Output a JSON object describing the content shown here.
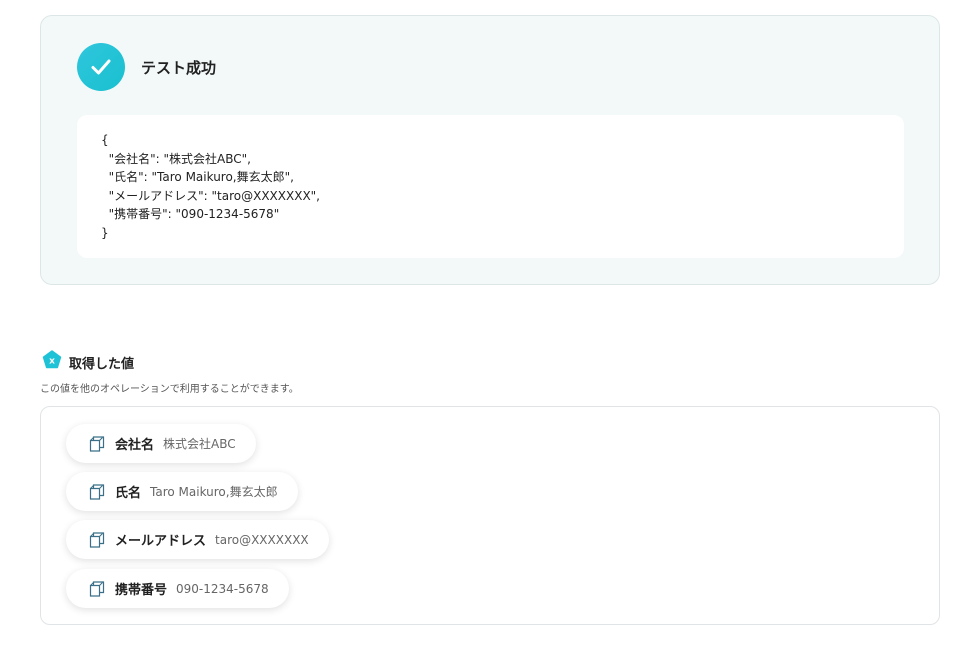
{
  "success": {
    "title": "テスト成功",
    "json_text": "{\n  \"会社名\": \"株式会社ABC\",\n  \"氏名\": \"Taro Maikuro,舞玄太郎\",\n  \"メールアドレス\": \"taro@XXXXXXX\",\n  \"携帯番号\": \"090-1234-5678\"\n}",
    "icon": "check-icon"
  },
  "section": {
    "title": "取得した値",
    "description": "この値を他のオペレーションで利用することができます。",
    "icon": "variable-x-icon"
  },
  "values": [
    {
      "label": "会社名",
      "value": "株式会社ABC",
      "icon": "copy-icon"
    },
    {
      "label": "氏名",
      "value": "Taro Maikuro,舞玄太郎",
      "icon": "copy-icon"
    },
    {
      "label": "メールアドレス",
      "value": "taro@XXXXXXX",
      "icon": "copy-icon"
    },
    {
      "label": "携帯番号",
      "value": "090-1234-5678",
      "icon": "copy-icon"
    }
  ],
  "colors": {
    "accent": "#1ec2d6",
    "panel_bg": "#f3f9f9"
  }
}
